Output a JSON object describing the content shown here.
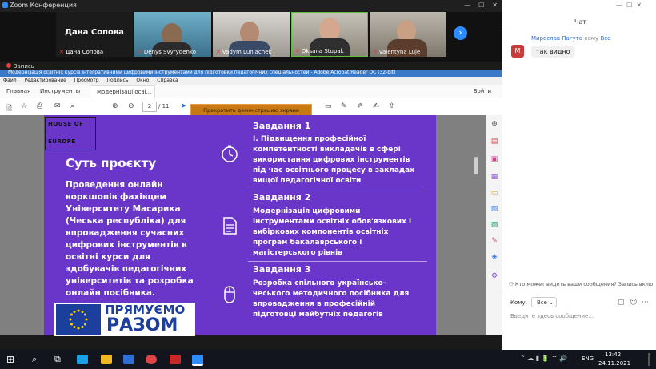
{
  "zoom": {
    "window_title": "Zoom Конференция",
    "recording": "Запись",
    "participants": [
      {
        "display": "Дана Сопова",
        "label": "Дана Сопова"
      },
      {
        "label": "Denys Svyrydenko"
      },
      {
        "label": "Vadym Luniachek"
      },
      {
        "label": "Oksana Stupak"
      },
      {
        "label": "valentyna Luje"
      }
    ],
    "next_icon": "chevron-right-icon"
  },
  "acrobat": {
    "window_title": "Модернізація освітніх курсів інтегративними цифровими інструментами для підготовки педагогічних спеціальностей - Adobe Acrobat Reader DC (32-bit)",
    "menu": [
      "Файл",
      "Редактирование",
      "Просмотр",
      "Подпись",
      "Окно",
      "Справка"
    ],
    "tabs": {
      "home": "Главная",
      "tools": "Инструменты",
      "doc": "Модернізаці осві..."
    },
    "sign_in": "Войти",
    "page_current": "2",
    "page_total": "/ 11",
    "stop_share": "Прекратить демонстрацию экрана"
  },
  "slide": {
    "logo_top": "HOUSE OF",
    "logo_bottom": "EUROPE",
    "project_title": "Суть проєкту",
    "project_text": "Проведення онлайн воркшопів фахівцем Університету Масарика (Чеська республіка) для впровадження сучасних цифрових інструментів в освітні курси для здобувачів педагогічних університетів та розробка онлайн посібника.",
    "eu_line1": "ПРЯМУЄМО",
    "eu_line2": "РАЗОМ",
    "tasks": [
      {
        "heading": "Завдання 1",
        "text": "І. Підвищення професійної компетентності викладачів в сфері використання цифрових інструментів під час освітнього процесу в закладах вищої педагогічної освіти",
        "icon": "clock-icon"
      },
      {
        "heading": "Завдання 2",
        "text": "Модернізація цифровими інструментами освітніх обов'язкових і вибіркових компонентів освітніх програм бакалаврського і магістерського рівнів",
        "icon": "document-icon"
      },
      {
        "heading": "Завдання 3",
        "text": "Розробка спільного українсько-чеського методичного посібника для впровадження в професійній підготовці майбутніх педагогів",
        "icon": "mouse-icon"
      }
    ]
  },
  "chat": {
    "title": "Чат",
    "sender": "Мирослав Пагута",
    "to_word": "кому",
    "to_target": "Все",
    "avatar_letter": "М",
    "message": "так видно",
    "notice": "Кто может видеть ваши сообщения? Запись включена",
    "to_label": "Кому:",
    "to_value": "Все",
    "input_placeholder": "Введите здесь сообщение..."
  },
  "taskbar": {
    "lang": "ENG",
    "time": "13:42",
    "date": "24.11.2021"
  },
  "colors": {
    "slide_purple": "#6a35c9",
    "zoom_blue": "#2d8cff",
    "stop_share_orange": "#c77a13",
    "eu_blue": "#1c3f9e"
  }
}
